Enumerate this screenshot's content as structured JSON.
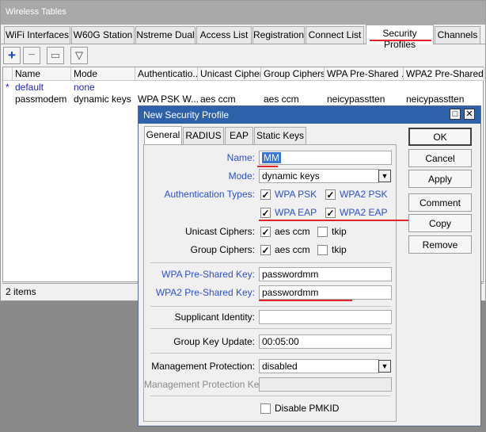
{
  "window": {
    "title": "Wireless Tables"
  },
  "tabs": [
    "WiFi Interfaces",
    "W60G Station",
    "Nstreme Dual",
    "Access List",
    "Registration",
    "Connect List",
    "Security Profiles",
    "Channels"
  ],
  "toolbar": {
    "add": "+",
    "remove": "−",
    "comment": "▭",
    "filter": "▽"
  },
  "table": {
    "columns": [
      "Name",
      "Mode",
      "Authenticatio...",
      "Unicast Ciphers",
      "Group Ciphers",
      "WPA Pre-Shared ...",
      "WPA2 Pre-Shared..."
    ],
    "rows": [
      {
        "mark": "*",
        "name": "default",
        "mode": "none",
        "auth": "",
        "unicast": "",
        "group": "",
        "wpa": "",
        "wpa2": ""
      },
      {
        "mark": "",
        "name": "passmodem",
        "mode": "dynamic keys",
        "auth": "WPA PSK W...",
        "unicast": "aes ccm",
        "group": "aes ccm",
        "wpa": "neicypasstten",
        "wpa2": "neicypasstten"
      }
    ]
  },
  "status": {
    "items": "2 items"
  },
  "dialog": {
    "title": "New Security Profile",
    "tabs": [
      "General",
      "RADIUS",
      "EAP",
      "Static Keys"
    ],
    "labels": {
      "name": "Name:",
      "mode": "Mode:",
      "auth": "Authentication Types:",
      "unicast": "Unicast Ciphers:",
      "group": "Group Ciphers:",
      "wpa": "WPA Pre-Shared Key:",
      "wpa2": "WPA2 Pre-Shared Key:",
      "supplicant": "Supplicant Identity:",
      "gku": "Group Key Update:",
      "mgmt": "Management Protection:",
      "mgmtkey": "Management Protection Key:"
    },
    "values": {
      "name": "MM",
      "mode": "dynamic keys",
      "wpa": "passwordmm",
      "wpa2": "passwordmm",
      "supplicant": "",
      "gku": "00:05:00",
      "mgmt": "disabled",
      "mgmtkey": ""
    },
    "checks": {
      "wpa_psk": "WPA PSK",
      "wpa2_psk": "WPA2 PSK",
      "wpa_eap": "WPA EAP",
      "wpa2_eap": "WPA2 EAP",
      "uc_aes": "aes ccm",
      "uc_tkip": "tkip",
      "gc_aes": "aes ccm",
      "gc_tkip": "tkip",
      "pmkid": "Disable PMKID"
    },
    "buttons": {
      "ok": "OK",
      "cancel": "Cancel",
      "apply": "Apply",
      "comment": "Comment",
      "copy": "Copy",
      "remove": "Remove"
    },
    "window_buttons": {
      "restore": "□",
      "close": "✕"
    }
  },
  "colors": {
    "dialog_title": "#2d62aa",
    "label_blue": "#2a4fcf",
    "highlight": "#e0242a"
  }
}
